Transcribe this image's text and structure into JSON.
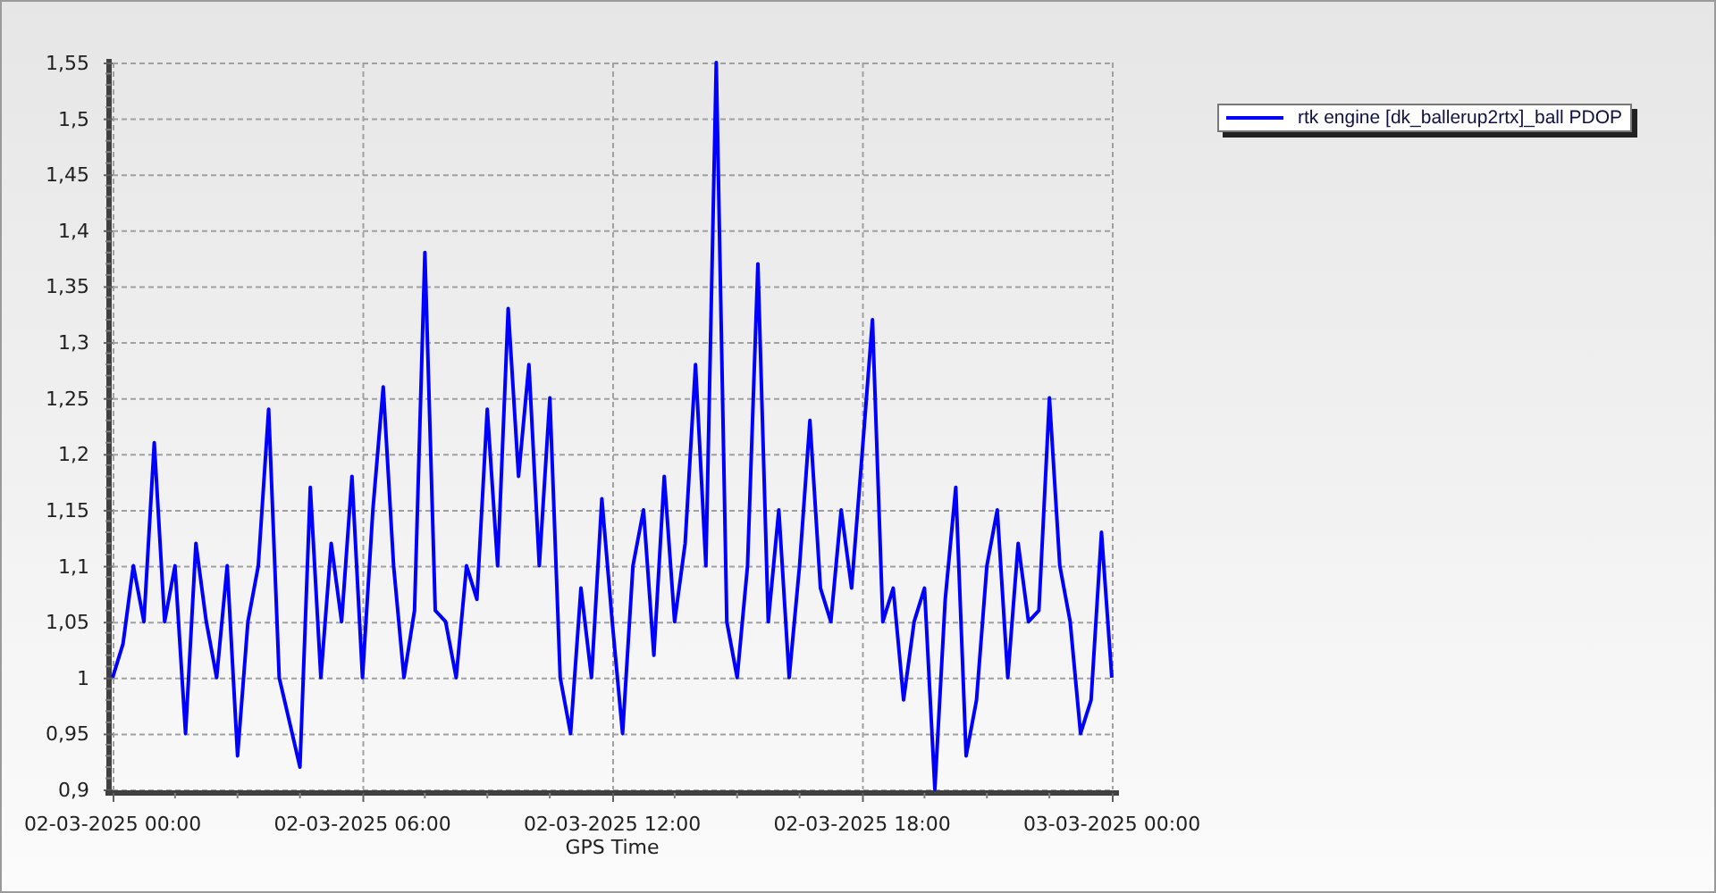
{
  "chart_data": {
    "type": "line",
    "xlabel": "GPS Time",
    "categories": [
      "02-03-2025 00:00",
      null,
      null,
      null,
      null,
      null,
      null,
      null,
      null,
      null,
      null,
      null,
      null,
      null,
      null,
      null,
      null,
      null,
      null,
      null,
      null,
      null,
      null,
      null,
      "02-03-2025 06:00",
      null,
      null,
      null,
      null,
      null,
      null,
      null,
      null,
      null,
      null,
      null,
      null,
      null,
      null,
      null,
      null,
      null,
      null,
      null,
      null,
      null,
      null,
      null,
      "02-03-2025 12:00",
      null,
      null,
      null,
      null,
      null,
      null,
      null,
      null,
      null,
      null,
      null,
      null,
      null,
      null,
      null,
      null,
      null,
      null,
      null,
      null,
      null,
      null,
      null,
      "02-03-2025 18:00",
      null,
      null,
      null,
      null,
      null,
      null,
      null,
      null,
      null,
      null,
      null,
      null,
      null,
      null,
      null,
      null,
      null,
      null,
      null,
      null,
      null,
      null,
      null,
      "03-03-2025 00:00"
    ],
    "series": [
      {
        "name": "rtk engine [dk_ballerup2rtx]_ball PDOP",
        "color": "#0000ff",
        "values": [
          1.0,
          1.03,
          1.1,
          1.05,
          1.21,
          1.05,
          1.1,
          0.95,
          1.12,
          1.05,
          1.0,
          1.1,
          0.93,
          1.05,
          1.1,
          1.24,
          1.0,
          0.96,
          0.92,
          1.17,
          1.0,
          1.12,
          1.05,
          1.18,
          1.0,
          1.15,
          1.26,
          1.1,
          1.0,
          1.06,
          1.38,
          1.06,
          1.05,
          1.0,
          1.1,
          1.07,
          1.24,
          1.1,
          1.33,
          1.18,
          1.28,
          1.1,
          1.25,
          1.0,
          0.95,
          1.08,
          1.0,
          1.16,
          1.05,
          0.95,
          1.1,
          1.15,
          1.02,
          1.18,
          1.05,
          1.12,
          1.28,
          1.1,
          1.55,
          1.05,
          1.0,
          1.1,
          1.37,
          1.05,
          1.15,
          1.0,
          1.1,
          1.23,
          1.08,
          1.05,
          1.15,
          1.08,
          1.2,
          1.32,
          1.05,
          1.08,
          0.98,
          1.05,
          1.08,
          0.9,
          1.07,
          1.17,
          0.93,
          0.98,
          1.1,
          1.15,
          1.0,
          1.12,
          1.05,
          1.06,
          1.25,
          1.1,
          1.05,
          0.95,
          0.98,
          1.13,
          1.0
        ]
      }
    ],
    "grid": true,
    "ylim": [
      0.9,
      1.55
    ],
    "yticks": [
      {
        "value": 0.9,
        "label": "0,9"
      },
      {
        "value": 0.95,
        "label": "0,95"
      },
      {
        "value": 1,
        "label": "1"
      },
      {
        "value": 1.05,
        "label": "1,05"
      },
      {
        "value": 1.1,
        "label": "1,1"
      },
      {
        "value": 1.15,
        "label": "1,15"
      },
      {
        "value": 1.2,
        "label": "1,2"
      },
      {
        "value": 1.25,
        "label": "1,25"
      },
      {
        "value": 1.3,
        "label": "1,3"
      },
      {
        "value": 1.35,
        "label": "1,35"
      },
      {
        "value": 1.4,
        "label": "1,4"
      },
      {
        "value": 1.45,
        "label": "1,45"
      },
      {
        "value": 1.5,
        "label": "1,5"
      },
      {
        "value": 1.55,
        "label": "1,55"
      }
    ]
  }
}
